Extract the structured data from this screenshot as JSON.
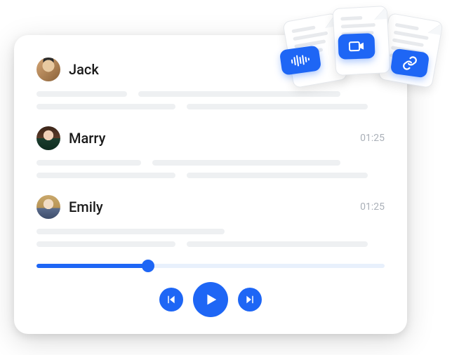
{
  "colors": {
    "accent": "#1e66f5",
    "placeholder": "#eef0f2",
    "muted": "#aab0b8"
  },
  "entries": [
    {
      "name": "Jack",
      "timestamp": "",
      "avatar": "jack"
    },
    {
      "name": "Marry",
      "timestamp": "01:25",
      "avatar": "marry"
    },
    {
      "name": "Emily",
      "timestamp": "01:25",
      "avatar": "emily"
    }
  ],
  "player": {
    "progress_percent": 32,
    "controls": {
      "prev": "previous-track",
      "play": "play",
      "next": "next-track"
    }
  },
  "attachments": {
    "badges": [
      "audio-waveform-icon",
      "video-icon",
      "link-icon"
    ]
  }
}
